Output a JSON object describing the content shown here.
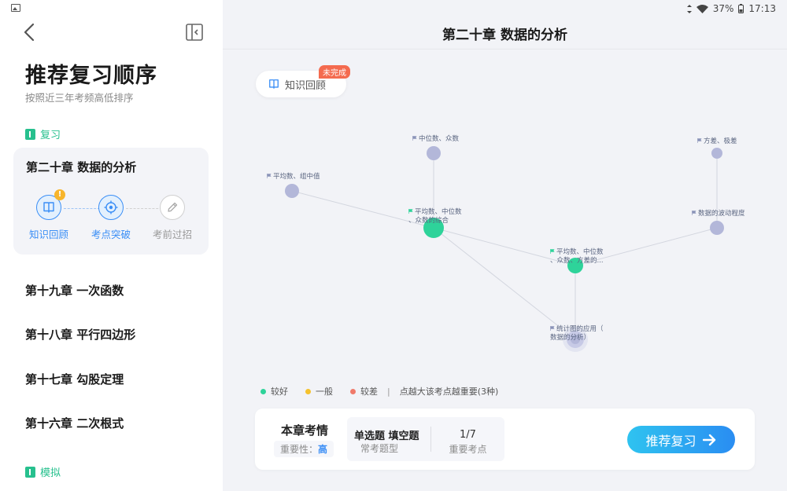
{
  "sidebar": {
    "title": "推荐复习顺序",
    "subtitle": "按照近三年考频高低排序",
    "review_section": "复习",
    "mock_section": "模拟",
    "current_chapter": {
      "title": "第二十章 数据的分析",
      "steps": [
        {
          "label": "知识回顾",
          "icon": "book-icon",
          "state": "active",
          "alert": "!"
        },
        {
          "label": "考点突破",
          "icon": "target-icon",
          "state": "active"
        },
        {
          "label": "考前过招",
          "icon": "pencil-icon",
          "state": "disabled"
        }
      ]
    },
    "chapters": [
      "第十九章 一次函数",
      "第十八章 平行四边形",
      "第十七章 勾股定理",
      "第十六章 二次根式"
    ]
  },
  "status_bar": {
    "battery": "37%",
    "time": "17:13"
  },
  "main": {
    "title": "第二十章 数据的分析",
    "knowledge_pill": "知识回顾",
    "incomplete_badge": "未完成",
    "nodes": [
      {
        "label": "中位数、众数",
        "status": "average-blue"
      },
      {
        "label": "平均数、组中值",
        "status": "average-blue"
      },
      {
        "label": "平均数、中位数\n、众数的综合",
        "status": "good"
      },
      {
        "label": "方差、极差",
        "status": "average-blue"
      },
      {
        "label": "数据的波动程度",
        "status": "average-blue"
      },
      {
        "label": "平均数、中位数\n、众数、方差的...",
        "status": "good"
      },
      {
        "label": "统计图的应用（\n数据的分析）",
        "status": "current"
      }
    ],
    "legend": {
      "good": "较好",
      "average": "一般",
      "poor": "较差",
      "note": "点越大该考点越重要(3种)",
      "colors": {
        "good": "#2ed39a",
        "average": "#f5c22e",
        "poor": "#f07a6a"
      }
    },
    "summary": {
      "title": "本章考情",
      "importance_label": "重要性：",
      "importance_value": "高",
      "question_types": "单选题 填空题",
      "question_types_sub": "常考题型",
      "key_points_count": "1/7",
      "key_points_sub": "重要考点",
      "recommend_button": "推荐复习"
    }
  }
}
